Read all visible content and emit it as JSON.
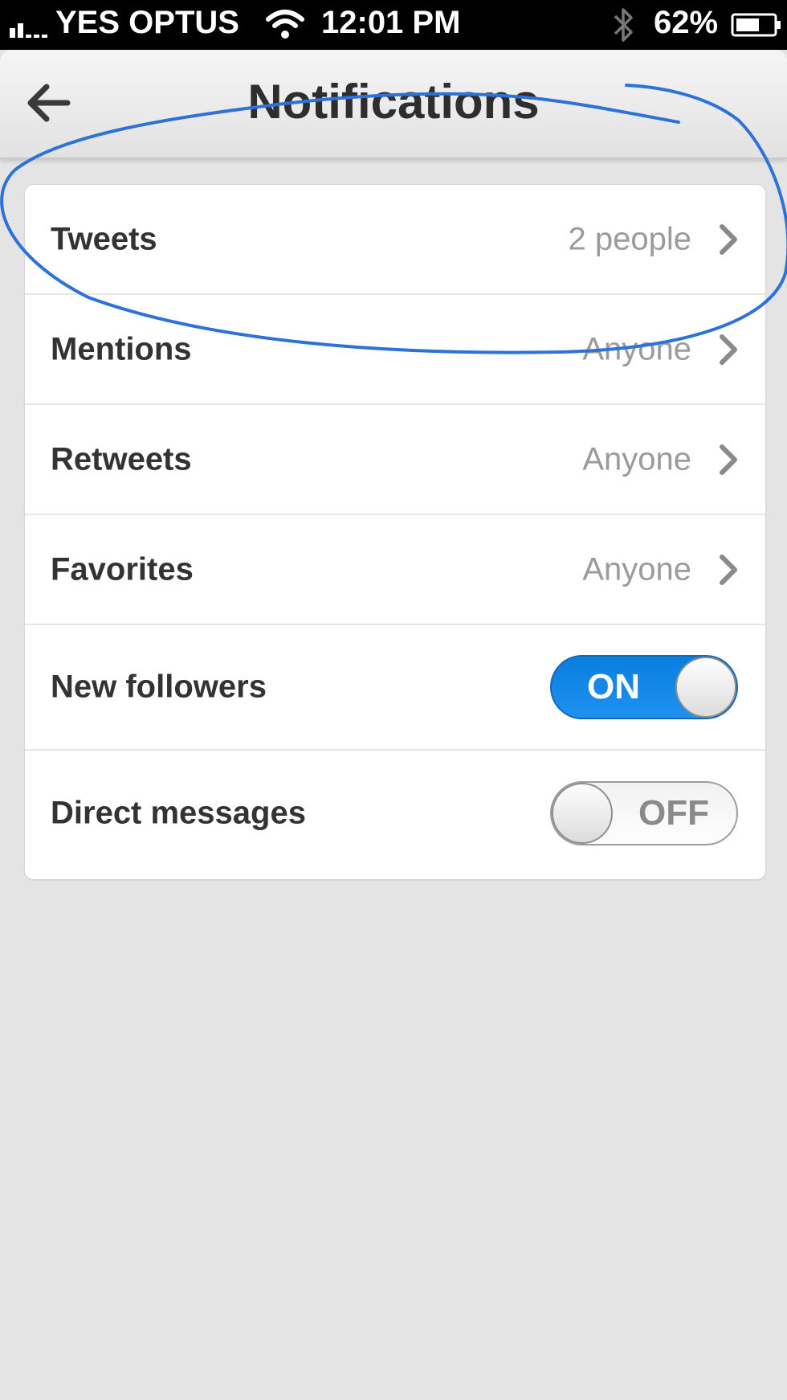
{
  "status_bar": {
    "carrier": "YES OPTUS",
    "time": "12:01 PM",
    "battery": "62%",
    "icons": [
      "signal-bars-icon",
      "wifi-icon",
      "bluetooth-icon",
      "battery-icon"
    ]
  },
  "nav": {
    "title": "Notifications",
    "back_icon": "back-arrow-icon"
  },
  "rows": [
    {
      "label": "Tweets",
      "value": "2 people",
      "icon": "chevron-right-icon"
    },
    {
      "label": "Mentions",
      "value": "Anyone",
      "icon": "chevron-right-icon"
    },
    {
      "label": "Retweets",
      "value": "Anyone",
      "icon": "chevron-right-icon"
    },
    {
      "label": "Favorites",
      "value": "Anyone",
      "icon": "chevron-right-icon"
    }
  ],
  "toggles": [
    {
      "label": "New followers",
      "state": "ON",
      "on": true
    },
    {
      "label": "Direct messages",
      "state": "OFF",
      "on": false
    }
  ],
  "colors": {
    "toggle_on": "#0a7fe0",
    "annotation_stroke": "#2d72d9",
    "background": "#e4e4e4"
  }
}
